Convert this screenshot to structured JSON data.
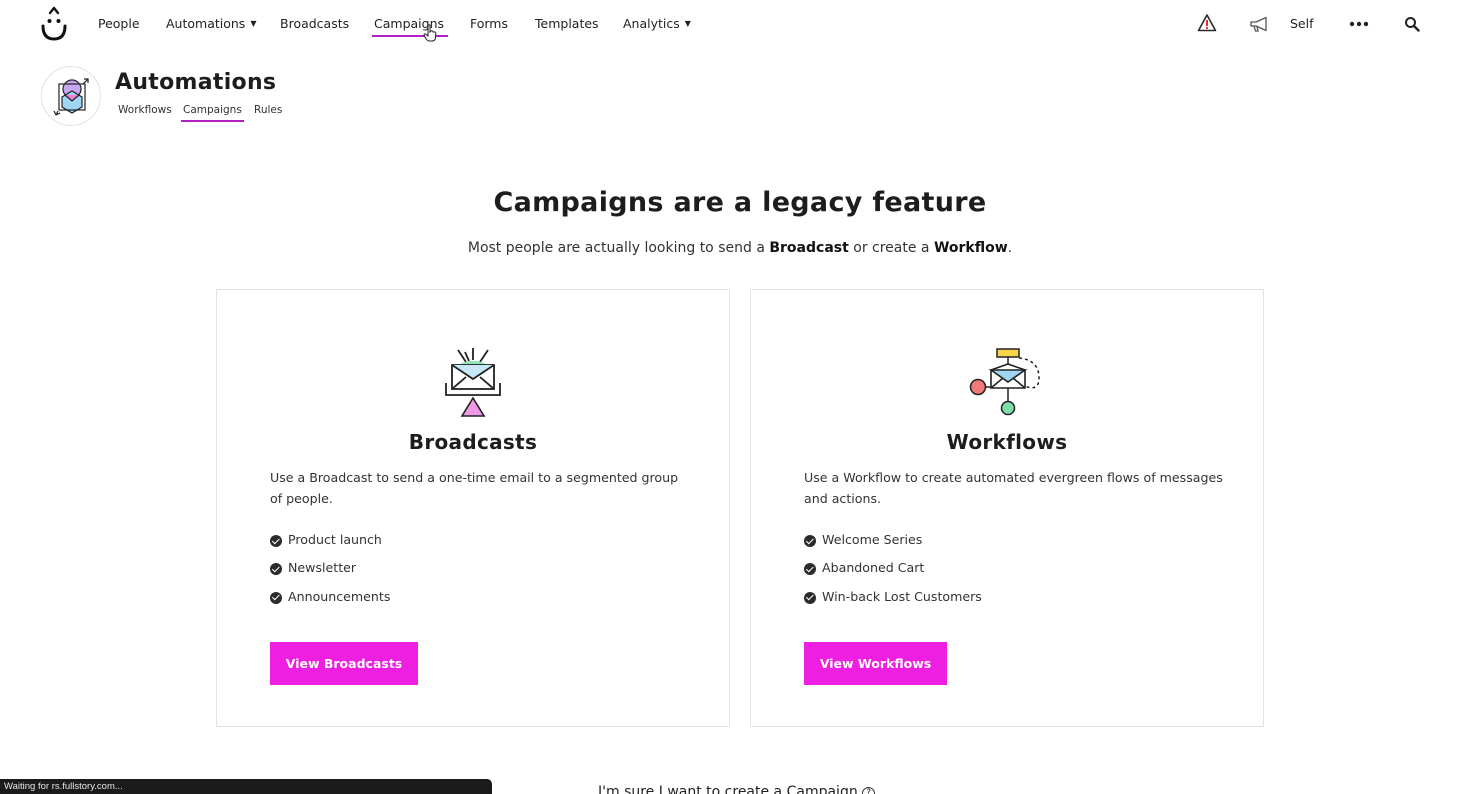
{
  "nav": {
    "items": [
      {
        "label": "People"
      },
      {
        "label": "Automations"
      },
      {
        "label": "Broadcasts"
      },
      {
        "label": "Campaigns"
      },
      {
        "label": "Forms"
      },
      {
        "label": "Templates"
      },
      {
        "label": "Analytics"
      }
    ],
    "active_item": "Campaigns",
    "account_label": "Self",
    "icons": [
      "alert-icon",
      "megaphone-icon",
      "more-icon",
      "search-icon"
    ]
  },
  "section": {
    "title": "Automations",
    "tabs": [
      {
        "label": "Workflows"
      },
      {
        "label": "Campaigns"
      },
      {
        "label": "Rules"
      }
    ],
    "active_tab": "Campaigns"
  },
  "main": {
    "headline": "Campaigns are a legacy feature",
    "subline_prefix": "Most people are actually looking to send a ",
    "subline_bold1": "Broadcast",
    "subline_mid": " or create a ",
    "subline_bold2": "Workflow",
    "subline_suffix": "."
  },
  "cards": [
    {
      "title": "Broadcasts",
      "description": "Use a Broadcast to send a one-time email to a segmented group of people.",
      "items": [
        "Product launch",
        "Newsletter",
        "Announcements"
      ],
      "button_label": "View Broadcasts"
    },
    {
      "title": "Workflows",
      "description": "Use a Workflow to create automated evergreen flows of messages and actions.",
      "items": [
        "Welcome Series",
        "Abandoned Cart",
        "Win-back Lost Customers"
      ],
      "button_label": "View Workflows"
    }
  ],
  "footer": {
    "status_text": "Waiting for rs.fullstory.com...",
    "create_campaign_link": "I'm sure I want to create a Campaign"
  },
  "colors": {
    "accent": "#ee1fe0",
    "underline": "#b21dc4",
    "alert": "#e0303a"
  }
}
